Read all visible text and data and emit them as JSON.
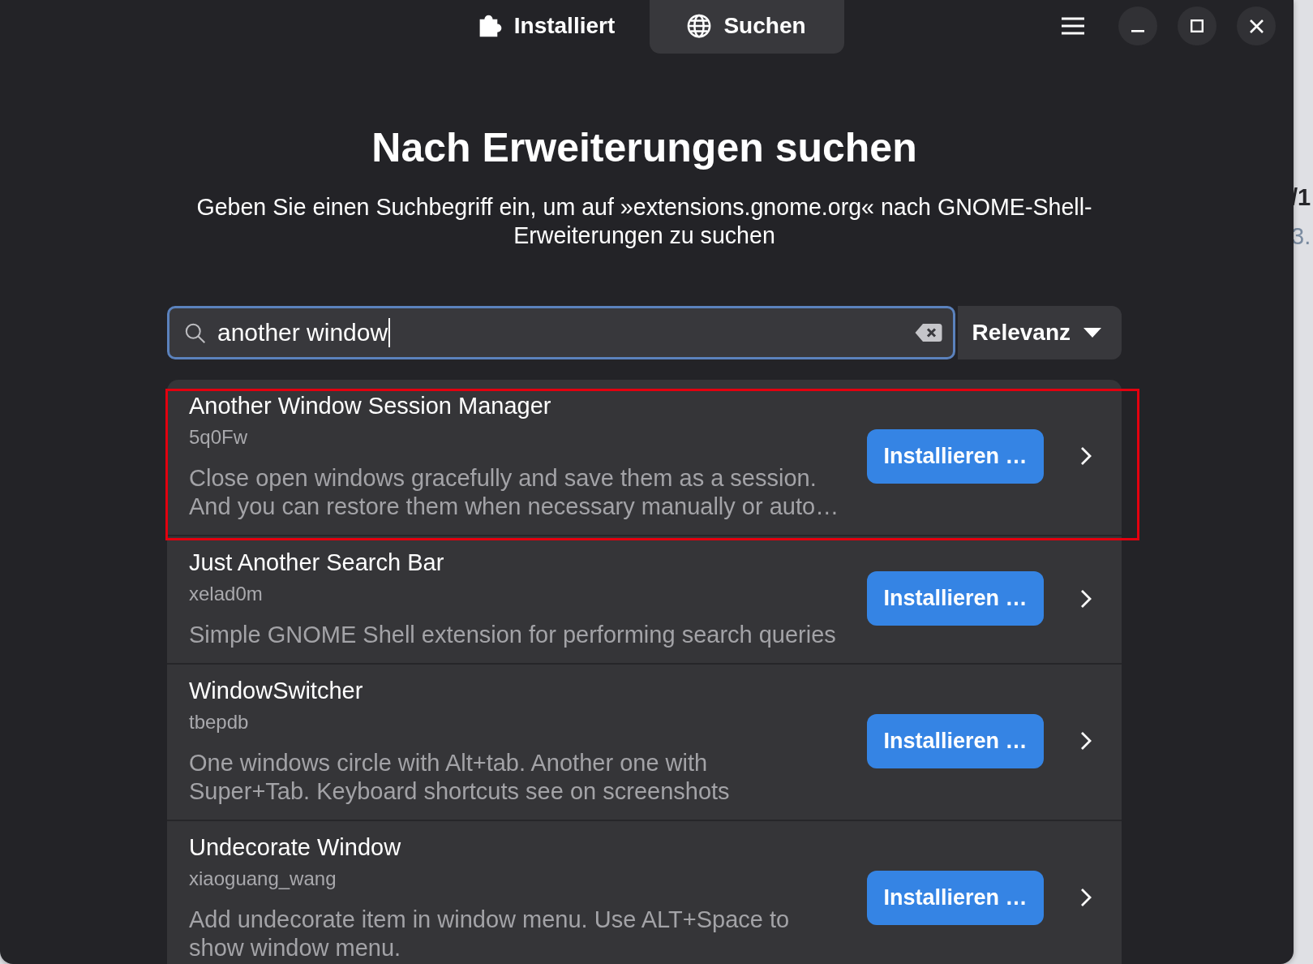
{
  "header": {
    "tabs": [
      {
        "label": "Installiert",
        "selected": false
      },
      {
        "label": "Suchen",
        "selected": true
      }
    ]
  },
  "intro": {
    "title": "Nach Erweiterungen suchen",
    "subtitle": "Geben Sie einen Suchbegriff ein, um auf »extensions.gnome.org« nach GNOME-Shell-Erweiterungen zu suchen"
  },
  "search": {
    "value": "another window",
    "focused": true
  },
  "sort": {
    "label": "Relevanz"
  },
  "results": [
    {
      "name": "Another Window Session Manager",
      "author": "5q0Fw",
      "description": "Close open windows gracefully and save them as a session.\nAnd you can restore them when necessary manually or auto…",
      "button": "Installieren …",
      "highlighted": true
    },
    {
      "name": "Just Another Search Bar",
      "author": "xelad0m",
      "description": "Simple GNOME Shell extension for performing search queries",
      "button": "Installieren …",
      "highlighted": false
    },
    {
      "name": "WindowSwitcher",
      "author": "tbepdb",
      "description": "One windows circle with Alt+tab. Another one with\nSuper+Tab. Keyboard shortcuts see on screenshots",
      "button": "Installieren …",
      "highlighted": false
    },
    {
      "name": "Undecorate Window",
      "author": "xiaoguang_wang",
      "description": "Add undecorate item in window menu. Use ALT+Space to\nshow window menu.",
      "button": "Installieren …",
      "highlighted": false
    }
  ],
  "background": {
    "texts": [
      {
        "text": "/1",
        "kind": "heading"
      },
      {
        "text": "3.",
        "kind": "meta"
      }
    ]
  }
}
